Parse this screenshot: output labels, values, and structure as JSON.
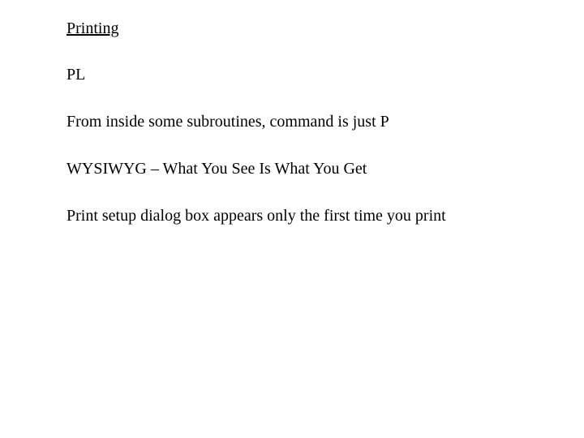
{
  "heading": "Printing",
  "lines": [
    "PL",
    "From inside some subroutines, command is just P",
    "WYSIWYG – What You See Is What You Get",
    "Print setup dialog box appears only the first time you print"
  ]
}
